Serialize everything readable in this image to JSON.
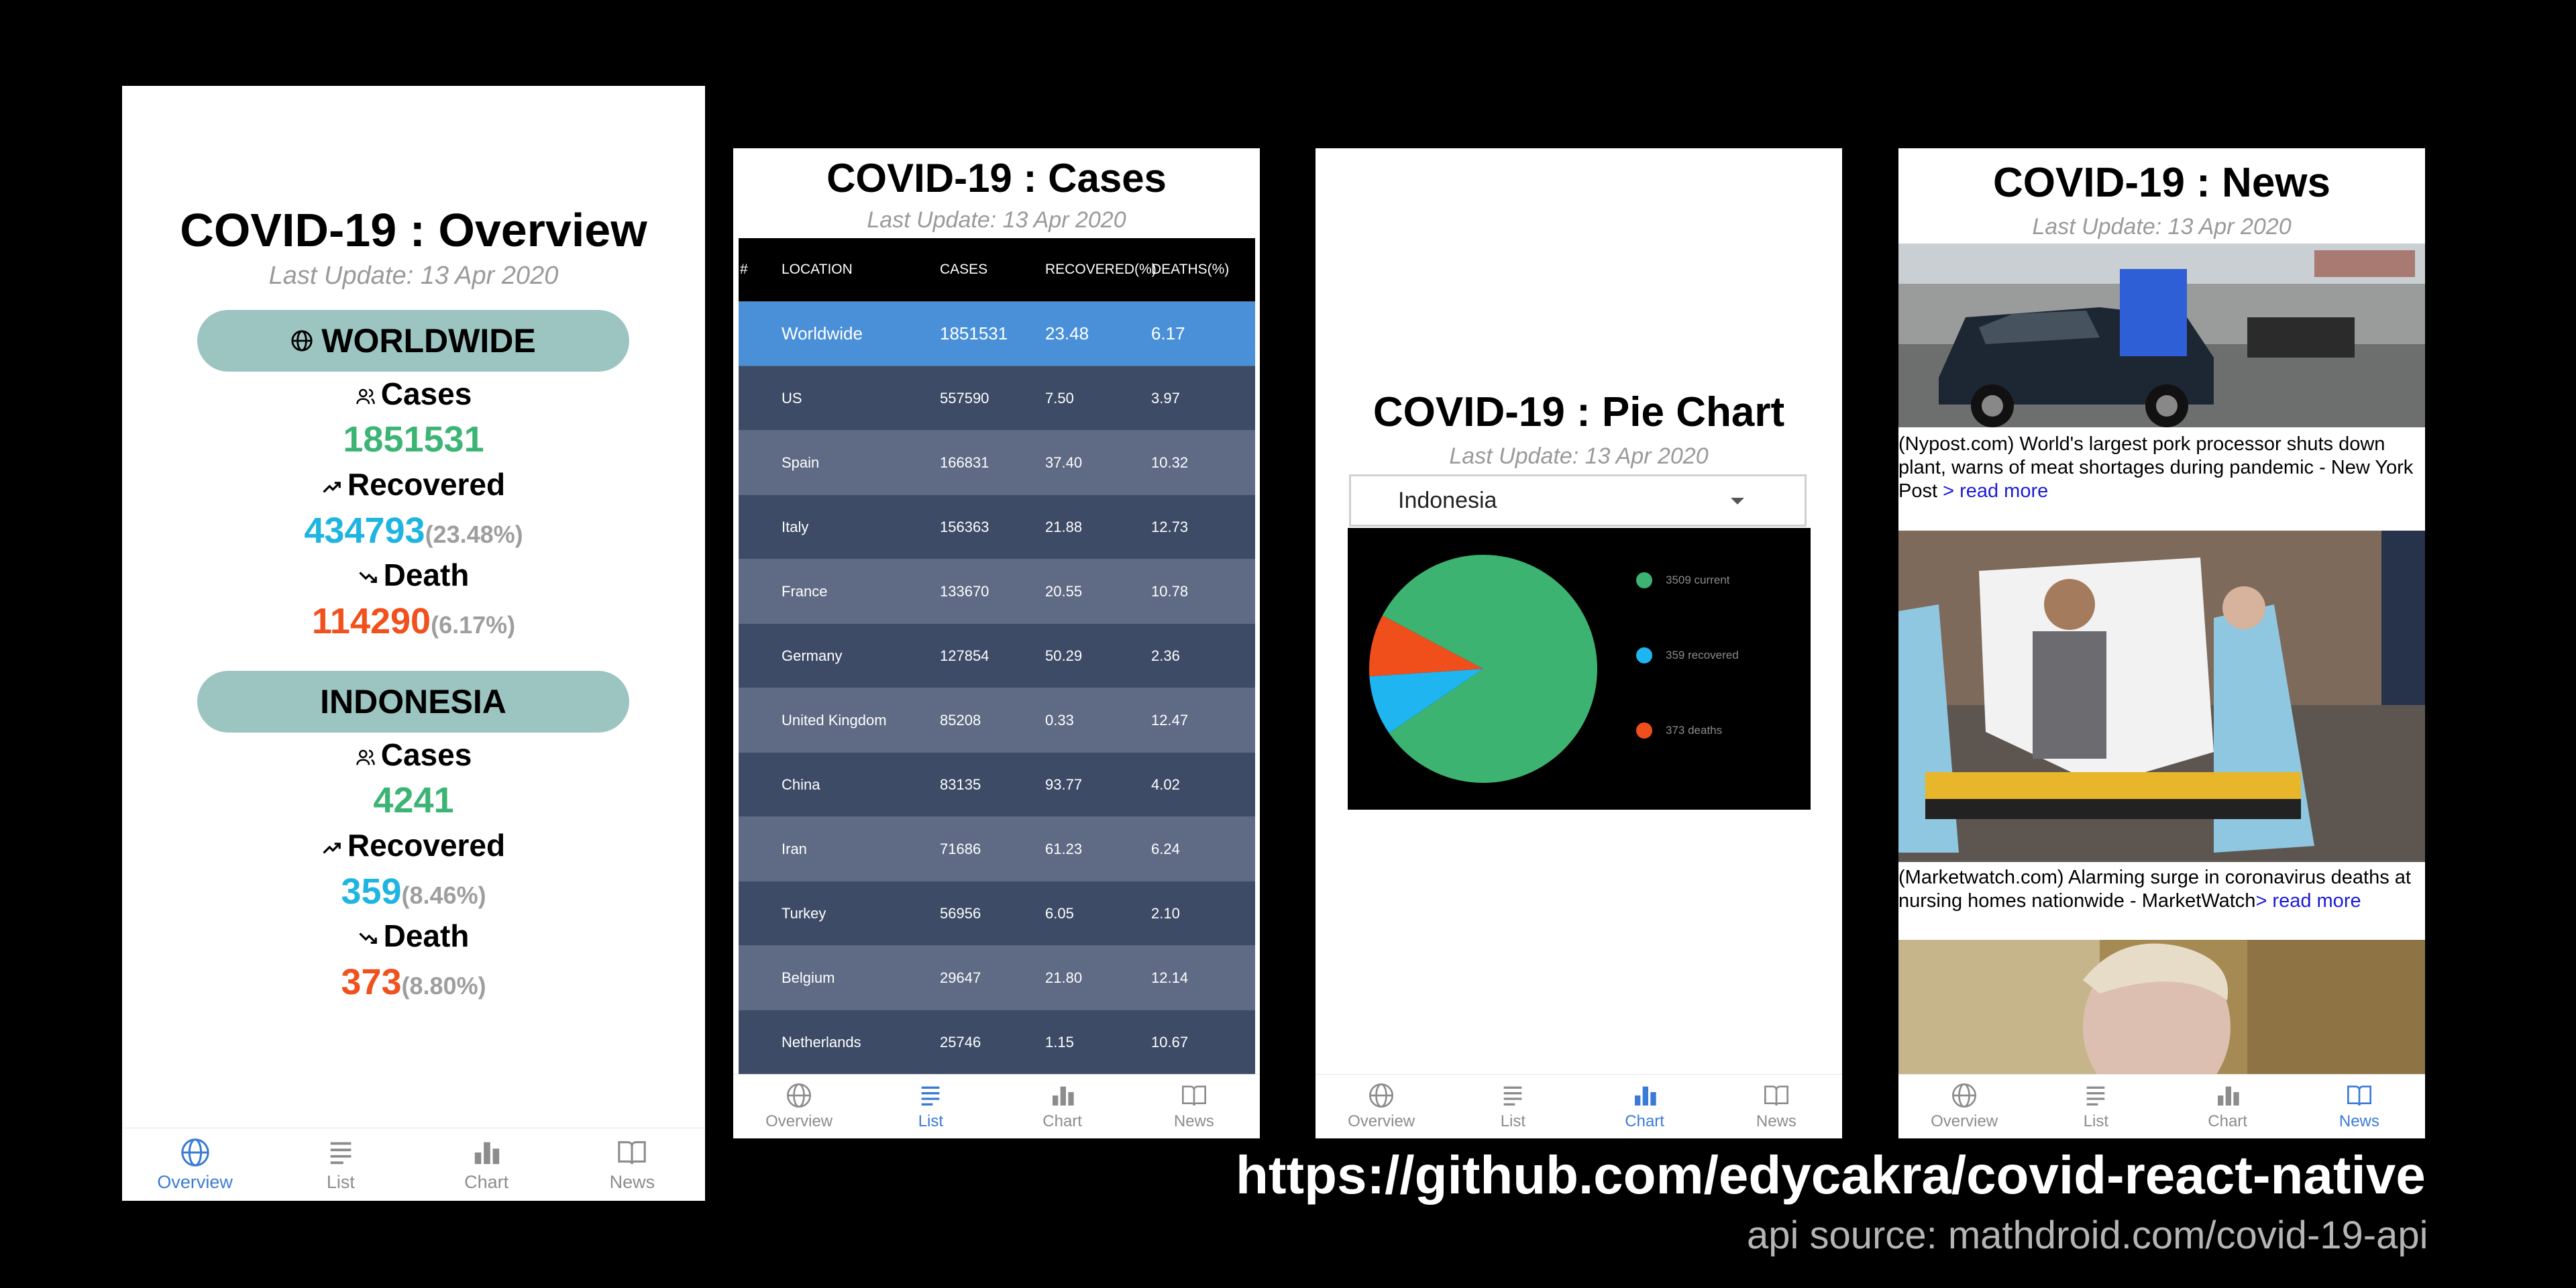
{
  "overview": {
    "title": "COVID-19 : Overview",
    "last_update": "Last Update: 13 Apr 2020",
    "worldwide": {
      "heading": "WORLDWIDE",
      "cases_label": "Cases",
      "cases": "1851531",
      "recovered_label": "Recovered",
      "recovered": "434793",
      "recovered_pct": "(23.48%)",
      "death_label": "Death",
      "death": "114290",
      "death_pct": "(6.17%)"
    },
    "indonesia": {
      "heading": "INDONESIA",
      "cases_label": "Cases",
      "cases": "4241",
      "recovered_label": "Recovered",
      "recovered": "359",
      "recovered_pct": "(8.46%)",
      "death_label": "Death",
      "death": "373",
      "death_pct": "(8.80%)"
    }
  },
  "cases": {
    "title": "COVID-19 : Cases",
    "last_update": "Last Update: 13 Apr 2020",
    "headers": [
      "#",
      "LOCATION",
      "CASES",
      "RECOVERED(%)",
      "DEATHS(%)"
    ],
    "rows": [
      [
        "Worldwide",
        "1851531",
        "23.48",
        "6.17"
      ],
      [
        "US",
        "557590",
        "7.50",
        "3.97"
      ],
      [
        "Spain",
        "166831",
        "37.40",
        "10.32"
      ],
      [
        "Italy",
        "156363",
        "21.88",
        "12.73"
      ],
      [
        "France",
        "133670",
        "20.55",
        "10.78"
      ],
      [
        "Germany",
        "127854",
        "50.29",
        "2.36"
      ],
      [
        "United Kingdom",
        "85208",
        "0.33",
        "12.47"
      ],
      [
        "China",
        "83135",
        "93.77",
        "4.02"
      ],
      [
        "Iran",
        "71686",
        "61.23",
        "6.24"
      ],
      [
        "Turkey",
        "56956",
        "6.05",
        "2.10"
      ],
      [
        "Belgium",
        "29647",
        "21.80",
        "12.14"
      ],
      [
        "Netherlands",
        "25746",
        "1.15",
        "10.67"
      ]
    ]
  },
  "pie": {
    "title": "COVID-19 : Pie Chart",
    "last_update": "Last Update: 13 Apr 2020",
    "selected_country": "Indonesia",
    "legend": [
      "3509 current",
      "359 recovered",
      "373 deaths"
    ]
  },
  "chart_data": {
    "type": "pie",
    "categories": [
      "current",
      "recovered",
      "deaths"
    ],
    "values": [
      3509,
      359,
      373
    ],
    "colors": [
      "#3cb371",
      "#1fb5f0",
      "#f04f1b"
    ],
    "legend_position": "right"
  },
  "news": {
    "title": "COVID-19 : News",
    "last_update": "Last Update: 13 Apr 2020",
    "read_more": "> read more",
    "items": [
      {
        "text": "(Nypost.com) World's largest pork processor shuts down plant, warns of meat shortages during pandemic - New York Post "
      },
      {
        "text": "(Marketwatch.com) Alarming surge in coronavirus deaths at nursing homes nationwide - MarketWatch"
      }
    ]
  },
  "tabs": [
    "Overview",
    "List",
    "Chart",
    "News"
  ],
  "colors": {
    "active_tab": "#3a7bd5",
    "cases": "#3cb474",
    "recovered": "#1fb5e0",
    "death": "#f0511d",
    "pill": "#9cc5c2"
  },
  "footer": {
    "url": "https://github.com/edycakra/covid-react-native",
    "api": "api source: mathdroid.com/covid-19-api"
  }
}
